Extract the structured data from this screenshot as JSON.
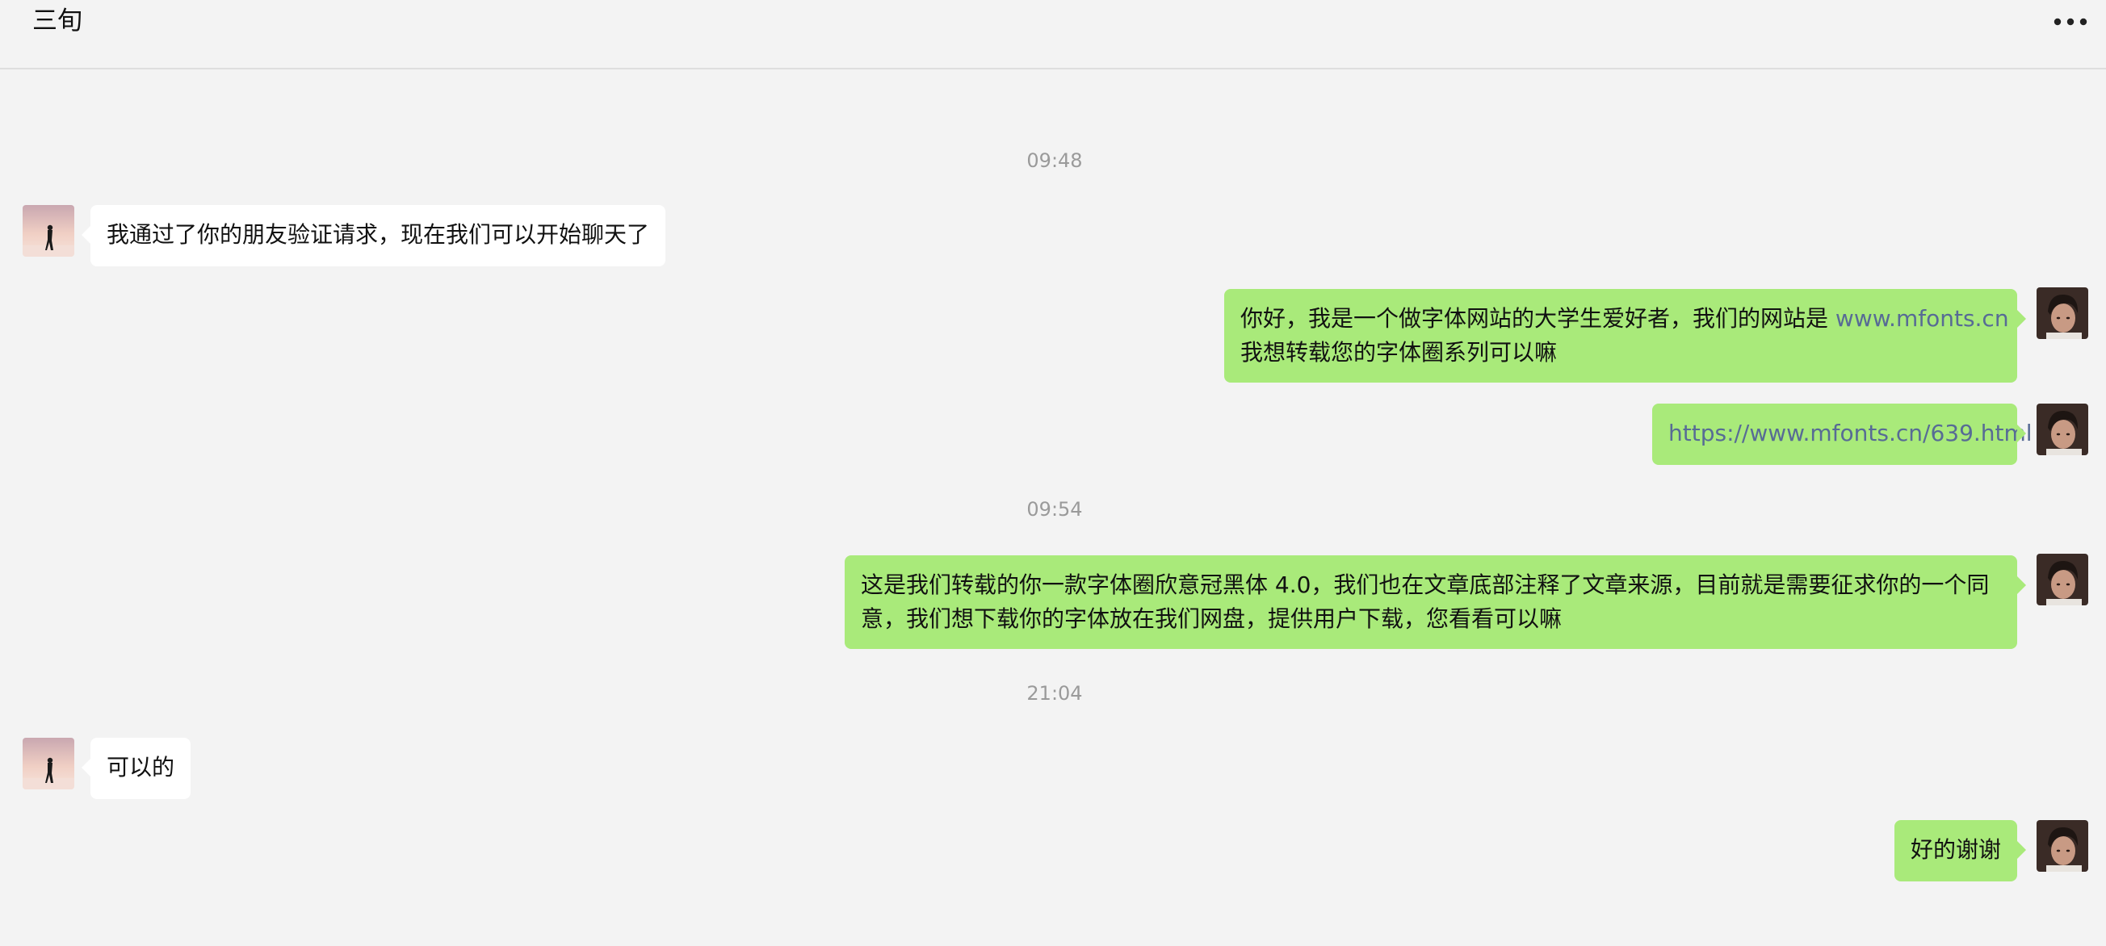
{
  "header": {
    "title": "三旬",
    "more_icon": "more-dots-icon"
  },
  "colors": {
    "background": "#f3f3f3",
    "bubble_incoming": "#ffffff",
    "bubble_outgoing": "#a9ea7a",
    "link": "#576b95",
    "timestamp": "#9a9a9a"
  },
  "messages": {
    "time_1": "09:48",
    "msg_1": "我通过了你的朋友验证请求，现在我们可以开始聊天了",
    "msg_2_text_a": "你好，我是一个做字体网站的大学生爱好者，我们的网站是",
    "msg_2_link": "www.mfonts.cn",
    "msg_2_text_b": "我想转载您的字体圈系列可以嘛",
    "msg_3_link": "https://www.mfonts.cn/639.html",
    "time_2": "09:54",
    "msg_4": "这是我们转载的你一款字体圈欣意冠黑体 4.0，我们也在文章底部注释了文章来源，目前就是需要征求你的一个同意，我们想下载你的字体放在我们网盘，提供用户下载，您看看可以嘛",
    "time_3": "21:04",
    "msg_5": "可以的",
    "msg_6": "好的谢谢"
  }
}
